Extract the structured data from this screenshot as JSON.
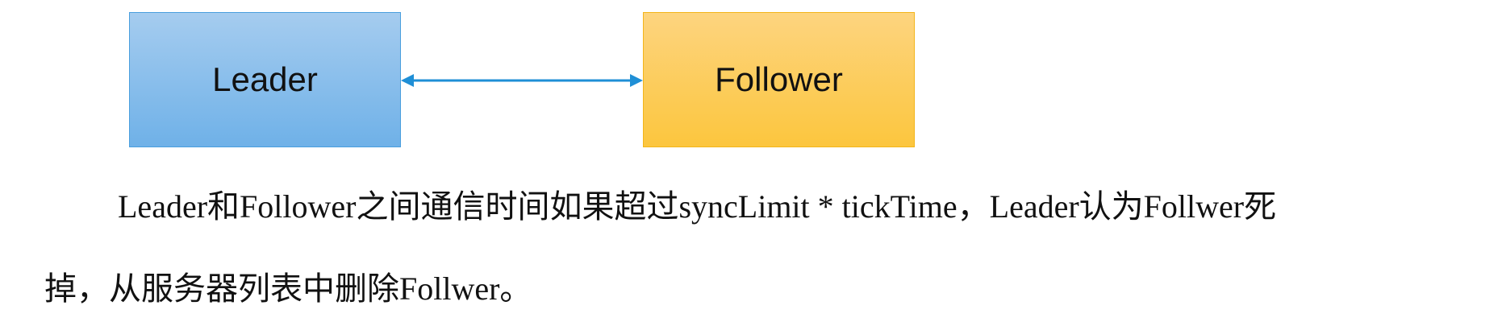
{
  "diagram": {
    "left_box_label": "Leader",
    "right_box_label": "Follower",
    "colors": {
      "leader_fill": "#7fbbea",
      "leader_border": "#4a9fde",
      "follower_fill": "#fdcd5a",
      "follower_border": "#f3b51a",
      "arrow": "#1f8fd6"
    },
    "arrow_icon": "double-headed-arrow"
  },
  "paragraph": {
    "line1": "Leader和Follower之间通信时间如果超过syncLimit * tickTime，Leader认为Follwer死",
    "line2": "掉，从服务器列表中删除Follwer。"
  }
}
